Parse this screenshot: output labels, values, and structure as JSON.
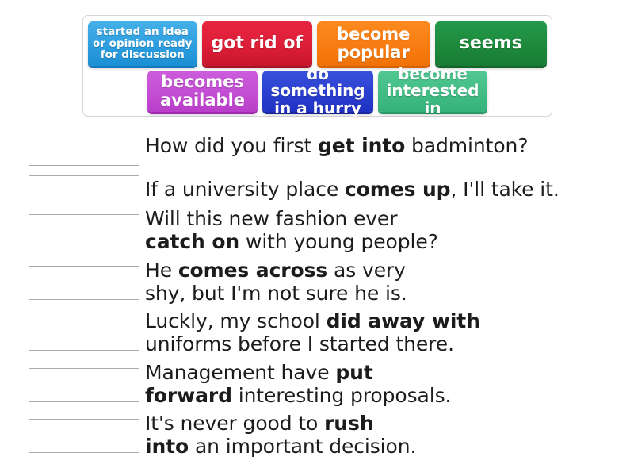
{
  "word_bank": {
    "rows": [
      [
        {
          "label": "started an idea\nor opinion ready\nfor discussion",
          "color": "#2f9fe0",
          "style": "t-blue"
        },
        {
          "label": "got rid of",
          "color": "#dd1f38",
          "style": "t-red"
        },
        {
          "label": "become\npopular",
          "color": "#f97d12",
          "style": "t-orange"
        },
        {
          "label": "seems",
          "color": "#1e8a3c",
          "style": "t-green"
        }
      ],
      [
        {
          "label": "becomes\navailable",
          "color": "#c44fd4",
          "style": "t-magenta"
        },
        {
          "label": "do something\nin a hurry",
          "color": "#2b3fd0",
          "style": "t-royal"
        },
        {
          "label": "become\ninterested in",
          "color": "#42bd85",
          "style": "t-teal"
        }
      ]
    ]
  },
  "questions": [
    {
      "answer_value": "",
      "before": "How did you first ",
      "phrasal_verb": "get into",
      "after": " badminton?"
    },
    {
      "answer_value": "",
      "before": "If a university place ",
      "phrasal_verb": "comes up",
      "after": ", I'll take it."
    },
    {
      "answer_value": "",
      "before": "Will this new fashion ever\n",
      "phrasal_verb": "catch on",
      "after": " with young people?"
    },
    {
      "answer_value": "",
      "before": "He ",
      "phrasal_verb": "comes across",
      "after": " as very\nshy, but I'm not sure he is."
    },
    {
      "answer_value": "",
      "before": "Luckly, my school ",
      "phrasal_verb": "did away with",
      "after": "\nuniforms before I started there."
    },
    {
      "answer_value": "",
      "before": "Management have ",
      "phrasal_verb": "put\nforward",
      "after": " interesting proposals."
    },
    {
      "answer_value": "",
      "before": "It's never good to ",
      "phrasal_verb": "rush\ninto",
      "after": " an important decision."
    }
  ]
}
